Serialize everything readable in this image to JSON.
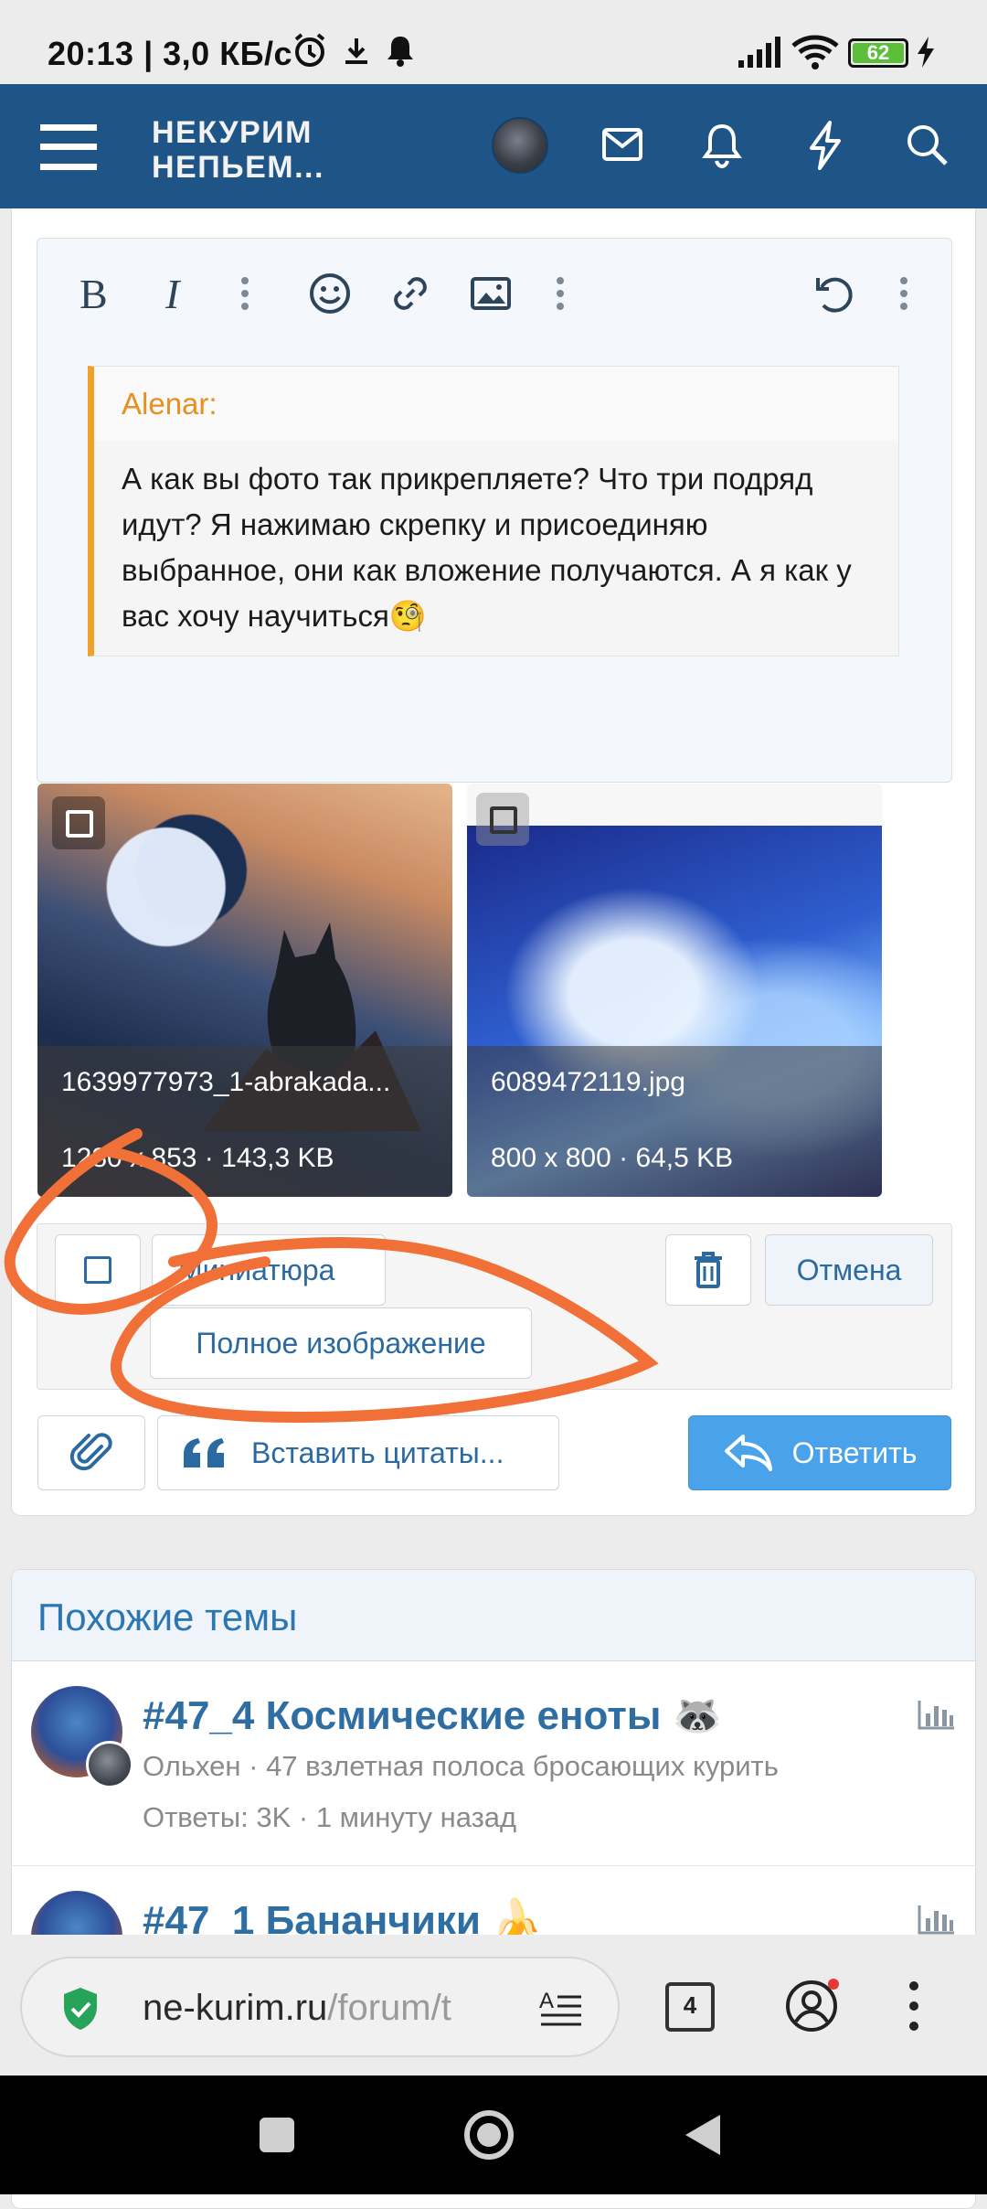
{
  "status_bar": {
    "time_and_speed": "20:13 | 3,0 КБ/с",
    "battery_level": "62"
  },
  "header": {
    "site_name_line1": "НЕКУРИМ",
    "site_name_line2": "НЕПЬЕМ..."
  },
  "quote": {
    "author": "Alenar:",
    "text": "А как вы фото так прикрепляете? Что три подряд идут? Я нажимаю скрепку и присоединяю выбранное, они как вложение получаются. А я как у вас хочу научиться🧐"
  },
  "attachments": [
    {
      "filename": "1639977973_1-abrakada...",
      "meta": "1280 x 853 · 143,3 KB"
    },
    {
      "filename": "6089472119.jpg",
      "meta": "800 x 800 · 64,5 KB"
    }
  ],
  "attachment_actions": {
    "thumbnail_label": "Миниатюра",
    "full_image_label": "Полное изображение",
    "cancel_label": "Отмена"
  },
  "reply_actions": {
    "insert_quotes_label": "Вставить цитаты...",
    "reply_label": "Ответить"
  },
  "similar_threads": {
    "title": "Похожие темы",
    "items": [
      {
        "title": "#47_4 Космические еноты 🦝",
        "author_forum": "Ольхен · 47 взлетная полоса бросающих курить",
        "stats": "Ответы: 3K · 1 минуту назад"
      },
      {
        "title": "#47_1 Бананчики 🍌",
        "author_forum": "",
        "stats": ""
      }
    ]
  },
  "browser": {
    "url_domain": "ne-kurim.ru",
    "url_path": "/forum/t",
    "tab_count": "4"
  },
  "colors": {
    "header_bg": "#1f5487",
    "link_blue": "#2e6ea3",
    "quote_accent": "#f0a12a",
    "reply_button": "#4aa3ea",
    "annotation_stroke": "#f07038"
  },
  "icons": {
    "editor_toolbar": [
      "bold-icon",
      "italic-icon",
      "more-vertical-icon",
      "smiley-icon",
      "link-icon",
      "image-icon",
      "more-vertical-icon",
      "undo-icon",
      "more-vertical-icon"
    ],
    "header": [
      "avatar",
      "mail-icon",
      "bell-icon",
      "bolt-icon",
      "search-icon"
    ]
  }
}
